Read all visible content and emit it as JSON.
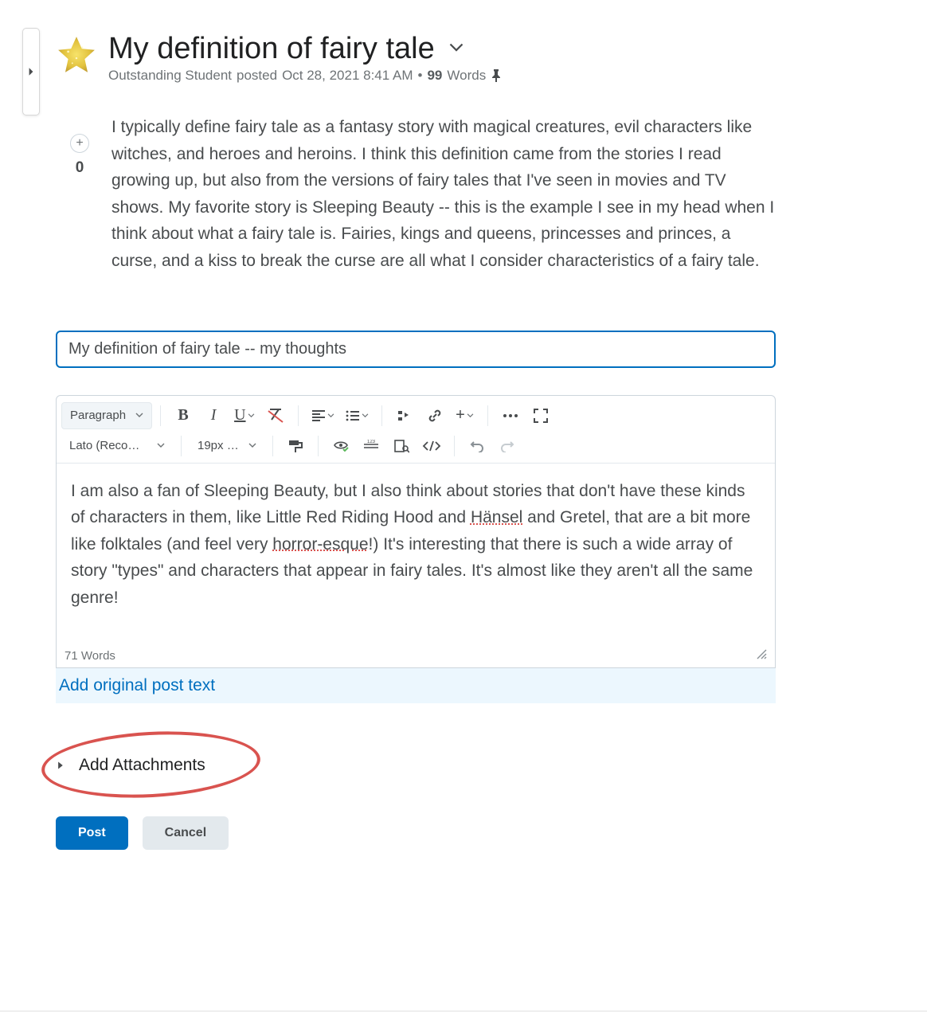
{
  "post": {
    "title": "My definition of fairy tale",
    "author": "Outstanding Student",
    "posted_label": "posted",
    "timestamp": "Oct 28, 2021 8:41 AM",
    "word_count_value": "99",
    "word_count_label": "Words",
    "body": "I typically define fairy tale as a fantasy story with magical creatures, evil characters like witches, and heroes and heroins. I think this definition came from the stories I read growing up, but also from the versions of fairy tales that I've seen in movies and TV shows. My favorite story is Sleeping Beauty -- this is the example I see in my head when I think about what a fairy tale is. Fairies, kings and queens, princesses and princes, a curse, and a kiss to break the curse are all what I consider characteristics of a fairy tale."
  },
  "vote": {
    "count": "0"
  },
  "reply": {
    "subject": "My definition of fairy tale -- my thoughts",
    "body_parts": {
      "p1": "I am also a fan of Sleeping Beauty, but I also think about stories that don't have these kinds of characters in them, like Little Red Riding Hood and ",
      "hansel": "Hänsel",
      "p2": " and Gretel, that are a bit more like folktales (and feel very ",
      "horror": "horror-esque",
      "p3": "!) It's interesting that there is such a wide array of story \"types\" and characters that appear in fairy tales. It's almost like they aren't all the same genre!"
    },
    "word_count": "71 Words"
  },
  "toolbar": {
    "format": "Paragraph",
    "font": "Lato (Recom…",
    "size": "19px …"
  },
  "links": {
    "add_original": "Add original post text",
    "add_attachments": "Add Attachments"
  },
  "buttons": {
    "post": "Post",
    "cancel": "Cancel"
  }
}
